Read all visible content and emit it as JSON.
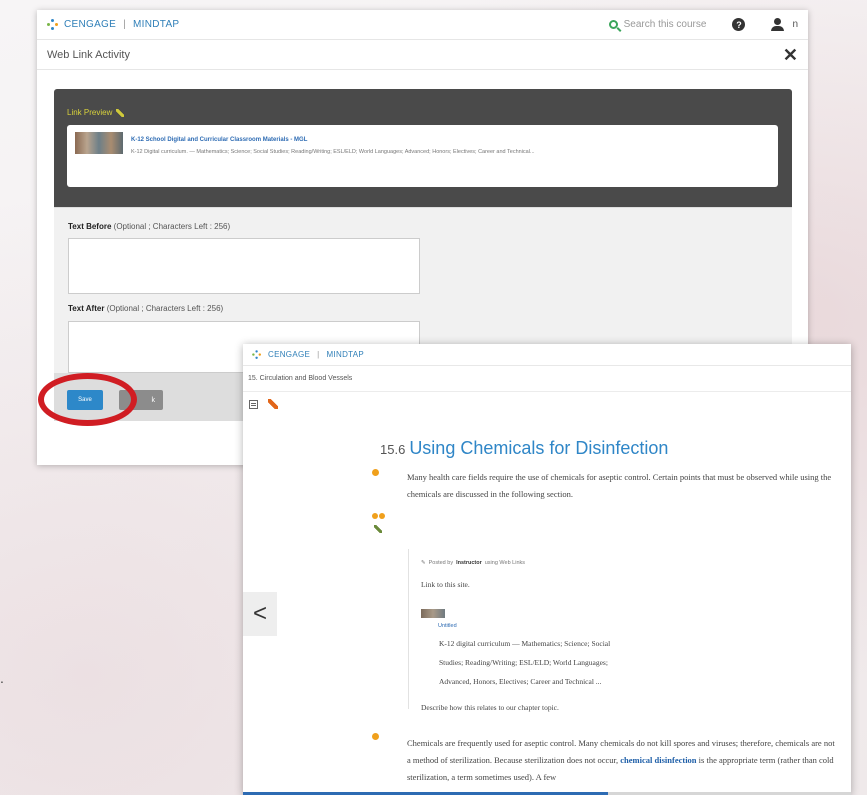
{
  "brand": {
    "left": "CENGAGE",
    "right": "MINDTAP"
  },
  "back_window": {
    "search_placeholder": "Search this course",
    "user_initial": "n",
    "title": "Web Link Activity",
    "close_glyph": "✕",
    "link_preview": {
      "label": "Link Preview",
      "title": "K-12 School Digital and Curricular Classroom Materials - MGL",
      "description": "K-12 Digital curriculum. — Mathematics; Science; Social Studies; Reading/Writing; ESL/ELD; World Languages; Advanced; Honors; Electives; Career and Technical..."
    },
    "text_before": {
      "label": "Text Before",
      "hint": "(Optional ; Characters Left : 256)"
    },
    "text_after": {
      "label": "Text After",
      "hint": "(Optional ; Characters Left : 256)"
    },
    "save_label": "Save",
    "back_label": "k"
  },
  "front_window": {
    "breadcrumb": "15. Circulation and Blood Vessels",
    "chapter_number": "15.6",
    "chapter_title": "Using Chemicals for Disinfection",
    "paragraph1": "Many health care fields require the use of chemicals for aseptic control. Certain points that must be observed while using the chemicals are discussed in the following section.",
    "ref": {
      "posted_prefix": "Posted by",
      "posted_by": "Instructor",
      "posted_suffix": "using Web Links",
      "intro": "Link to this site.",
      "link_label": "Untitled",
      "line1": "K-12 digital curriculum — Mathematics; Science; Social",
      "line2": "Studies; Reading/Writing; ESL/ELD; World Languages;",
      "line3": "Advanced, Honors, Electives; Career and Technical ...",
      "prompt": "Describe how this relates to our chapter topic."
    },
    "paragraph2_a": "Chemicals are frequently used for aseptic control. Many chemicals do not kill spores and viruses; therefore, chemicals are not a method of sterilization. Because sterilization does not occur,",
    "paragraph2_b": "chemical disinfection",
    "paragraph2_c": "is the appropriate term (rather than cold sterilization, a term sometimes used). A few",
    "prev_glyph": "<",
    "progress": 0.6
  },
  "stray_text": ".",
  "colors": {
    "accent": "#2f86c7",
    "highlight": "#d01d23",
    "marker": "#f0a01c"
  }
}
